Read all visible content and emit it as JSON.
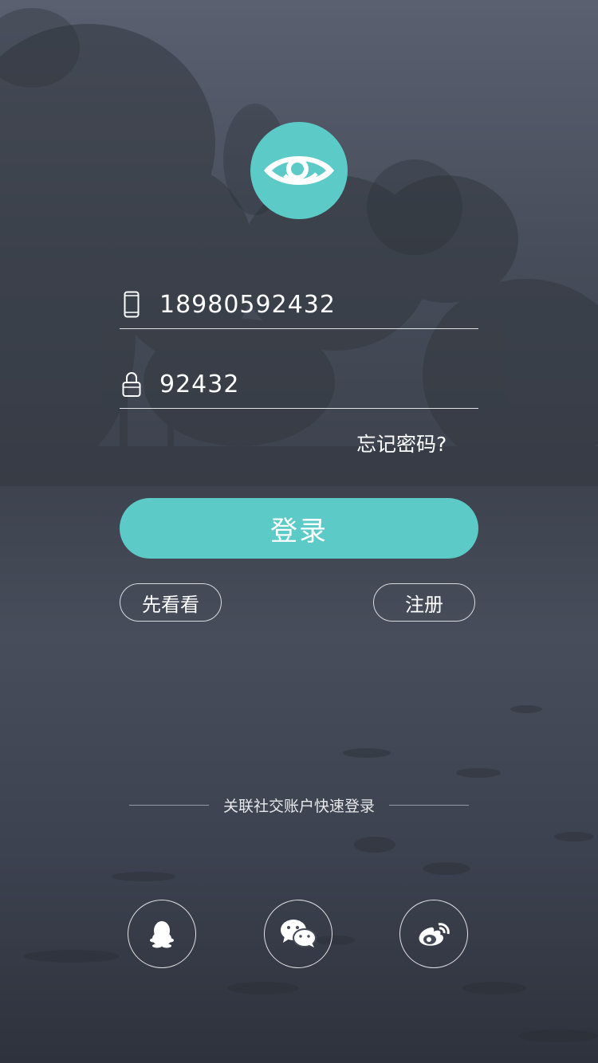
{
  "theme": {
    "accent": "#5ccbc8",
    "text": "#ffffff"
  },
  "logo": {
    "icon": "eye-icon"
  },
  "phone_field": {
    "icon": "phone-icon",
    "value": "18980592432"
  },
  "password_field": {
    "icon": "lock-icon",
    "value": "92432"
  },
  "forgot_password": "忘记密码?",
  "login_button": "登录",
  "browse_button": "先看看",
  "register_button": "注册",
  "social_login": {
    "label": "关联社交账户快速登录",
    "items": [
      {
        "icon": "qq-icon"
      },
      {
        "icon": "wechat-icon"
      },
      {
        "icon": "weibo-icon"
      }
    ]
  }
}
